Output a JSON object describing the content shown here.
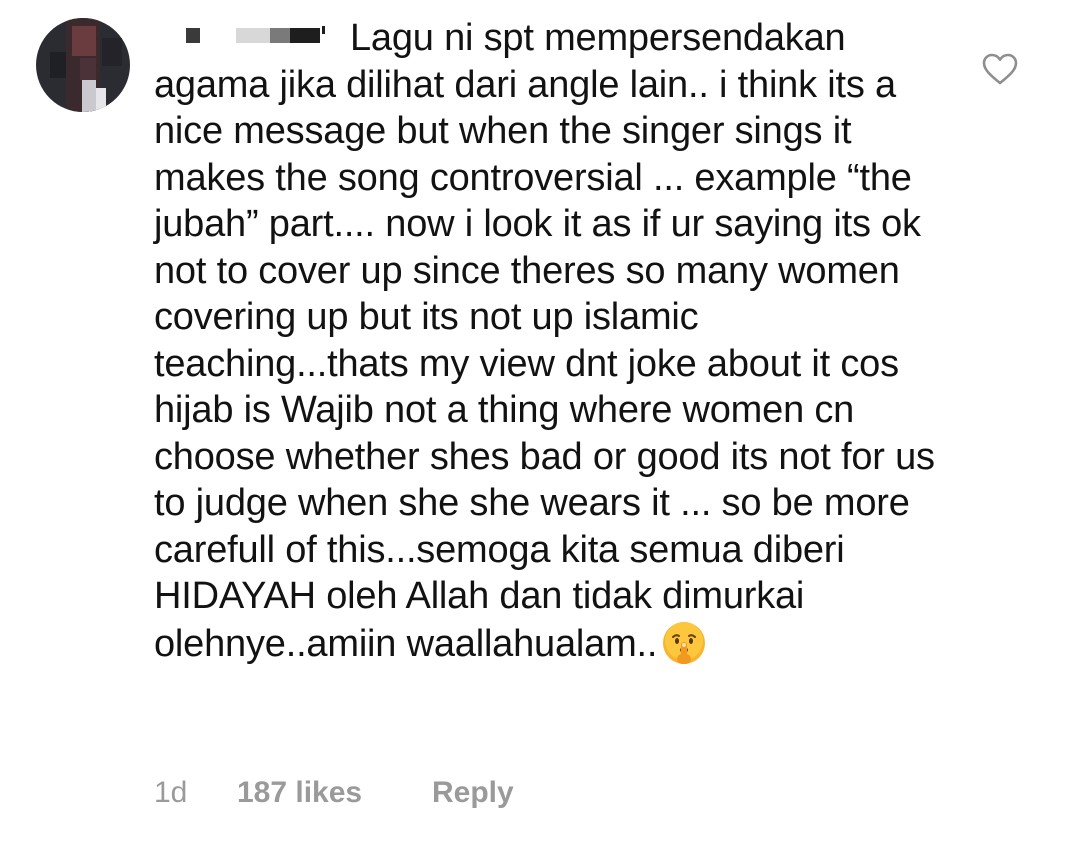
{
  "comment": {
    "username": "",
    "text": "Lagu ni spt mempersendakan agama jika dilihat dari angle lain.. i think its a nice message but when the singer sings it makes the song controversial ... example “the jubah” part.... now i look it as if ur saying its ok not to cover up since theres so many women covering up but its not up islamic teaching...thats my view dnt joke about it cos hijab is Wajib not a thing where women cn choose whether shes bad or good its not for us to judge when she she wears it ... so be more carefull of this...semoga  kita semua diberi HIDAYAH oleh Allah dan tidak dimurkai olehnye..amiin waallahualam..",
    "emoji": "shushing-face-icon",
    "time": "1d",
    "likes": "187 likes",
    "reply_label": "Reply",
    "like_icon": "heart-outline-icon"
  },
  "colors": {
    "text": "#121212",
    "secondary": "#9a9a9a",
    "background": "#ffffff",
    "emoji_face": "#f7b42c"
  }
}
